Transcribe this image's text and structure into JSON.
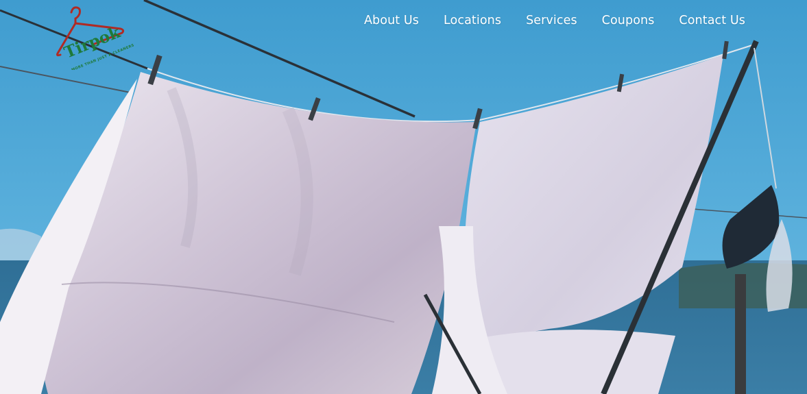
{
  "brand": {
    "name": "Tirpok",
    "tagline": "MORE THAN JUST A CLEANERS",
    "colors": {
      "green": "#1e7a3a",
      "red": "#b02a24"
    }
  },
  "nav": {
    "items": [
      {
        "label": "About Us"
      },
      {
        "label": "Locations"
      },
      {
        "label": "Services"
      },
      {
        "label": "Coupons"
      },
      {
        "label": "Contact Us"
      }
    ]
  },
  "hero": {
    "description": "",
    "colors": {
      "sky": "#4aa3d4",
      "sheet": "#e8e4ee"
    }
  }
}
